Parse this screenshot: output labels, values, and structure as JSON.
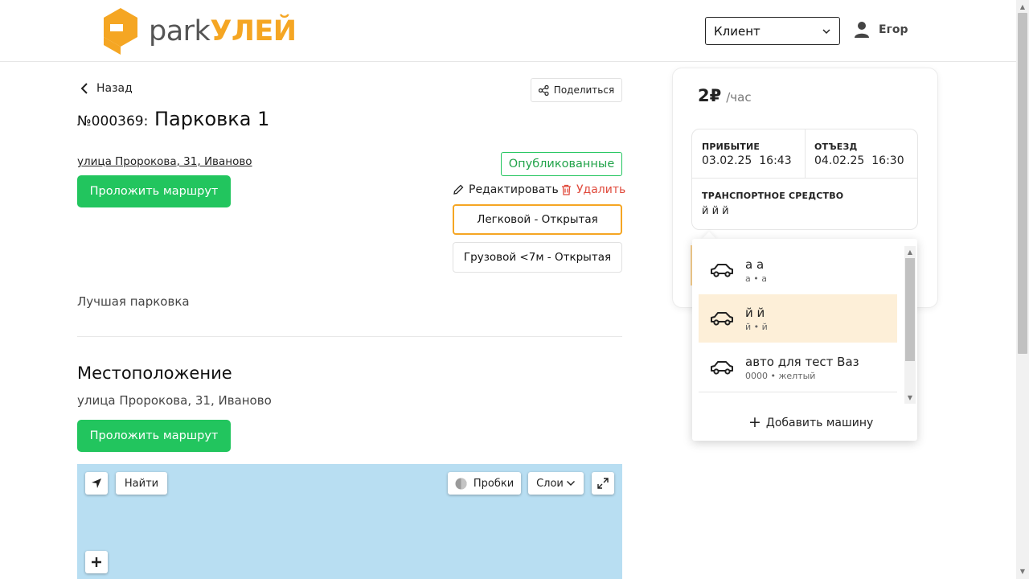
{
  "header": {
    "logo_park": "park",
    "logo_brand": "УЛЕЙ",
    "role_select": "Клиент",
    "user_name": "Егор"
  },
  "listing": {
    "back_label": "Назад",
    "share_label": "Поделиться",
    "number": "№000369:",
    "name": "Парковка 1",
    "address": "улица Пророкова, 31, Иваново",
    "route_label": "Проложить маршрут",
    "status": "Опубликованные",
    "edit_label": "Редактировать",
    "delete_label": "Удалить",
    "spots": [
      "Легковой - Открытая",
      "Грузовой <7м - Открытая"
    ],
    "description": "Лучшая парковка"
  },
  "location": {
    "title": "Местоположение",
    "address": "улица Пророкова, 31, Иваново",
    "route_label": "Проложить маршрут"
  },
  "map": {
    "find_label": "Найти",
    "traffic_label": "Пробки",
    "layers_label": "Слои"
  },
  "booking": {
    "price": "2₽",
    "unit": "/час",
    "arrival_label": "ПРИБЫТИЕ",
    "arrival_date": "03.02.25",
    "arrival_time": "16:43",
    "departure_label": "ОТЪЕЗД",
    "departure_date": "04.02.25",
    "departure_time": "16:30",
    "vehicle_label": "ТРАНСПОРТНОЕ СРЕДСТВО",
    "vehicle_value": "й й й"
  },
  "vehicles": {
    "items": [
      {
        "name": "а а",
        "sub": "а • а"
      },
      {
        "name": "й й",
        "sub": "й • й"
      },
      {
        "name": "авто для тест Ваз",
        "sub": "0000 • желтый"
      }
    ],
    "add_label": "Добавить машину"
  },
  "colors": {
    "accent": "#f5a623",
    "primary_button": "#22c55e",
    "danger": "#e04a3c",
    "selected_row": "#fdefd8",
    "map_water": "#b8def2"
  }
}
